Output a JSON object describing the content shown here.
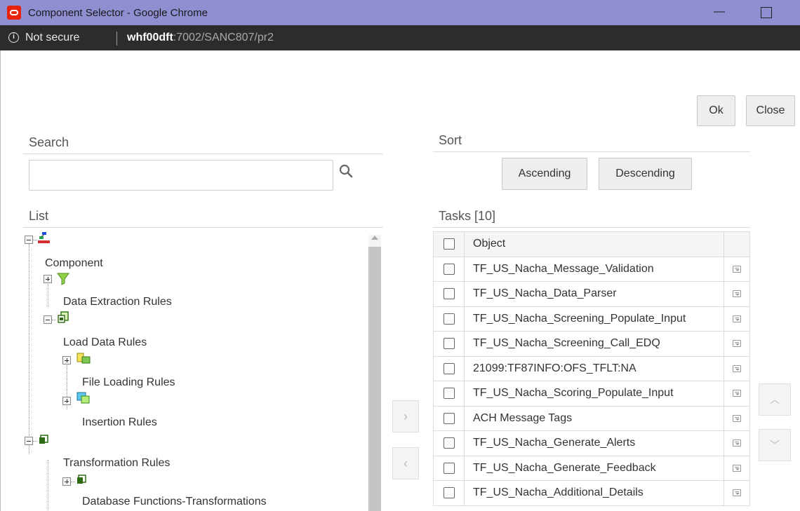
{
  "window": {
    "title": "Component Selector - Google Chrome",
    "minimize": "—"
  },
  "addressbar": {
    "security": "Not secure",
    "host": "whf00dft",
    "path": ":7002/SANC807/pr2"
  },
  "actions": {
    "ok": "Ok",
    "close": "Close"
  },
  "search": {
    "label": "Search",
    "value": "",
    "placeholder": ""
  },
  "list": {
    "label": "List",
    "tree": [
      {
        "label": "Component"
      },
      {
        "label": "Data Extraction Rules"
      },
      {
        "label": "Load Data Rules"
      },
      {
        "label": "File Loading Rules"
      },
      {
        "label": "Insertion Rules"
      },
      {
        "label": "Transformation Rules"
      },
      {
        "label": "Database Functions-Transformations"
      }
    ]
  },
  "sort": {
    "label": "Sort",
    "ascending": "Ascending",
    "descending": "Descending"
  },
  "tasks": {
    "label": "Tasks [10]",
    "column_object": "Object",
    "rows": [
      "TF_US_Nacha_Message_Validation",
      "TF_US_Nacha_Data_Parser",
      "TF_US_Nacha_Screening_Populate_Input",
      "TF_US_Nacha_Screening_Call_EDQ",
      "21099:TF87INFO:OFS_TFLT:NA",
      "TF_US_Nacha_Scoring_Populate_Input",
      "ACH Message Tags",
      "TF_US_Nacha_Generate_Alerts",
      "TF_US_Nacha_Generate_Feedback",
      "TF_US_Nacha_Additional_Details"
    ]
  },
  "move": {
    "add": "›",
    "remove": "‹"
  },
  "reorder": {
    "up": "︿",
    "down": "﹀"
  },
  "colors": {
    "titlebar": "#8e8ed0",
    "addressbar": "#2c2c2c",
    "brand": "#e8230b"
  }
}
